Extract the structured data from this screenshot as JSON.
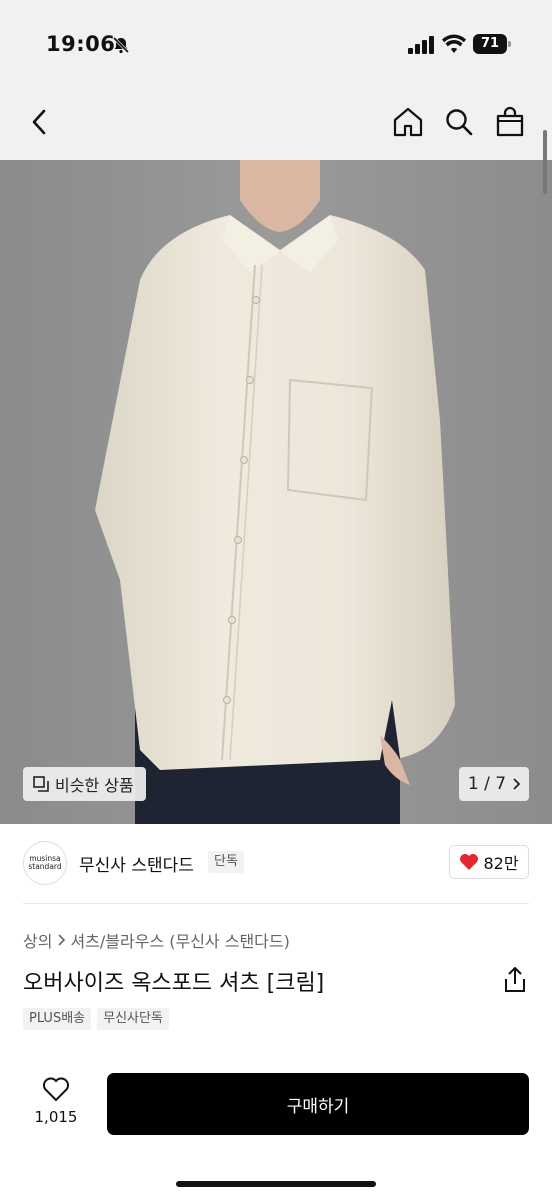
{
  "status_bar": {
    "time": "19:06",
    "battery": "71",
    "icons": [
      "bell-slash-icon",
      "signal-icon",
      "wifi-icon",
      "battery-icon"
    ]
  },
  "nav": {
    "icons": [
      "back-arrow-icon",
      "home-icon",
      "search-icon",
      "shopping-bag-icon"
    ]
  },
  "gallery": {
    "similar_label": "비슷한 상품",
    "counter": "1 / 7",
    "image_bg": "#8f8f8f"
  },
  "brand": {
    "logo_line1": "musinsa",
    "logo_line2": "standard",
    "name": "무신사 스탠다드",
    "badge": "단독",
    "likes": "82만"
  },
  "product": {
    "breadcrumb": [
      "상의",
      "셔츠/블라우스 (무신사 스탠다드)"
    ],
    "title": "오버사이즈 옥스포드 셔츠 [크림]",
    "tags": [
      "PLUS배송",
      "무신사단독"
    ]
  },
  "bottom": {
    "wish_count": "1,015",
    "buy_label": "구매하기"
  },
  "colors": {
    "accent_heart": "#e5272f",
    "buy_button": "#000000",
    "shirt": "#ece7da"
  }
}
